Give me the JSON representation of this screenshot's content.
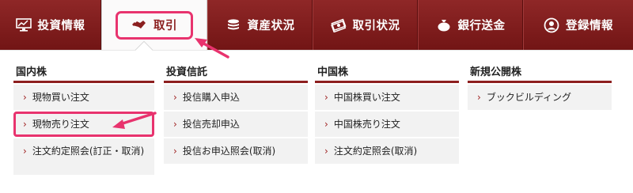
{
  "nav": {
    "items": [
      {
        "label": "投資情報",
        "icon": "monitor-chart-icon"
      },
      {
        "label": "取引",
        "icon": "handshake-icon"
      },
      {
        "label": "資産状況",
        "icon": "coins-icon"
      },
      {
        "label": "取引状況",
        "icon": "bills-icon"
      },
      {
        "label": "銀行送金",
        "icon": "money-bag-icon"
      },
      {
        "label": "登録情報",
        "icon": "user-circle-icon"
      }
    ]
  },
  "menu": {
    "columns": [
      {
        "heading": "国内株",
        "items": [
          "現物買い注文",
          "現物売り注文",
          "注文約定照会(訂正・取消)"
        ]
      },
      {
        "heading": "投資信託",
        "items": [
          "投信購入申込",
          "投信売却申込",
          "投信お申込照会(取消)"
        ]
      },
      {
        "heading": "中国株",
        "items": [
          "中国株買い注文",
          "中国株売り注文",
          "注文約定照会(取消)"
        ]
      },
      {
        "heading": "新規公開株",
        "items": [
          "ブックビルディング"
        ]
      }
    ]
  },
  "colors": {
    "nav_bg": "#7f1d1d",
    "accent": "#8d1f1f",
    "highlight": "#e8336e"
  }
}
